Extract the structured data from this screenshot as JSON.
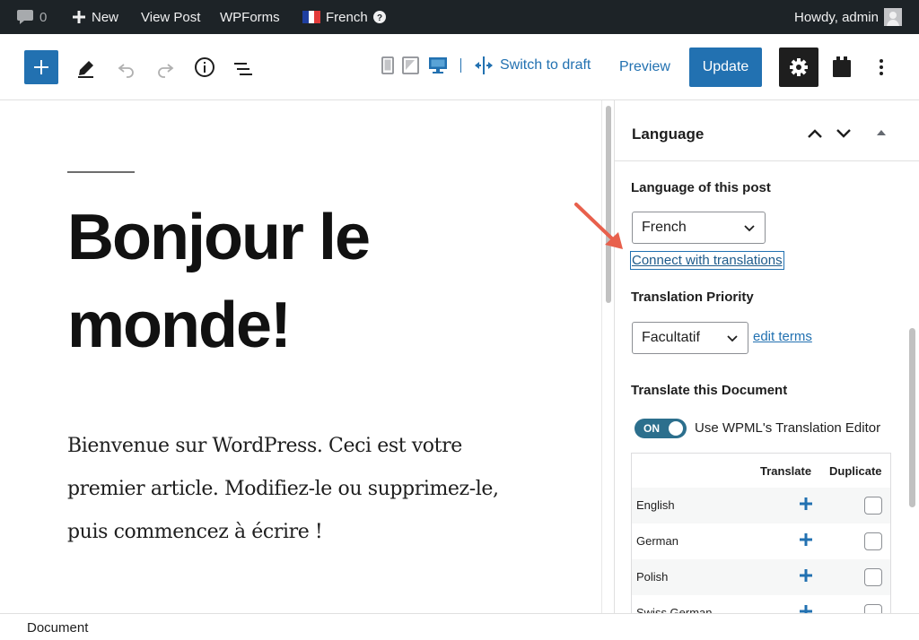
{
  "adminbar": {
    "comments_count": "0",
    "new_label": "New",
    "view_post_label": "View Post",
    "wpforms_label": "WPForms",
    "language_label": "French",
    "howdy_label": "Howdy, admin"
  },
  "toolbar": {
    "switch_to_draft_label": "Switch to draft",
    "preview_label": "Preview",
    "update_label": "Update"
  },
  "post": {
    "title_line1": "Bonjour le",
    "title_line2": "monde!",
    "paragraph_line1": "Bienvenue sur WordPress. Ceci est votre",
    "paragraph_line2": "premier article. Modifiez-le ou supprimez-le,",
    "paragraph_line3": "puis commencez à écrire !"
  },
  "sidebar": {
    "panel_title": "Language",
    "language_of_post_label": "Language of this post",
    "language_selected": "French",
    "connect_link": "Connect with translations",
    "priority_label": "Translation Priority",
    "priority_selected": "Facultatif",
    "edit_terms_link": "edit terms",
    "translate_doc_label": "Translate this Document",
    "toggle_state": "ON",
    "toggle_label": "Use WPML's Translation Editor",
    "table": {
      "col_translate": "Translate",
      "col_duplicate": "Duplicate",
      "rows": [
        {
          "language": "English"
        },
        {
          "language": "German"
        },
        {
          "language": "Polish"
        },
        {
          "language": "Swiss German"
        }
      ]
    }
  },
  "footer": {
    "label": "Document"
  },
  "colors": {
    "admin_bar": "#1d2327",
    "accent_blue": "#2271b1",
    "annotation_arrow": "#e8604c"
  }
}
